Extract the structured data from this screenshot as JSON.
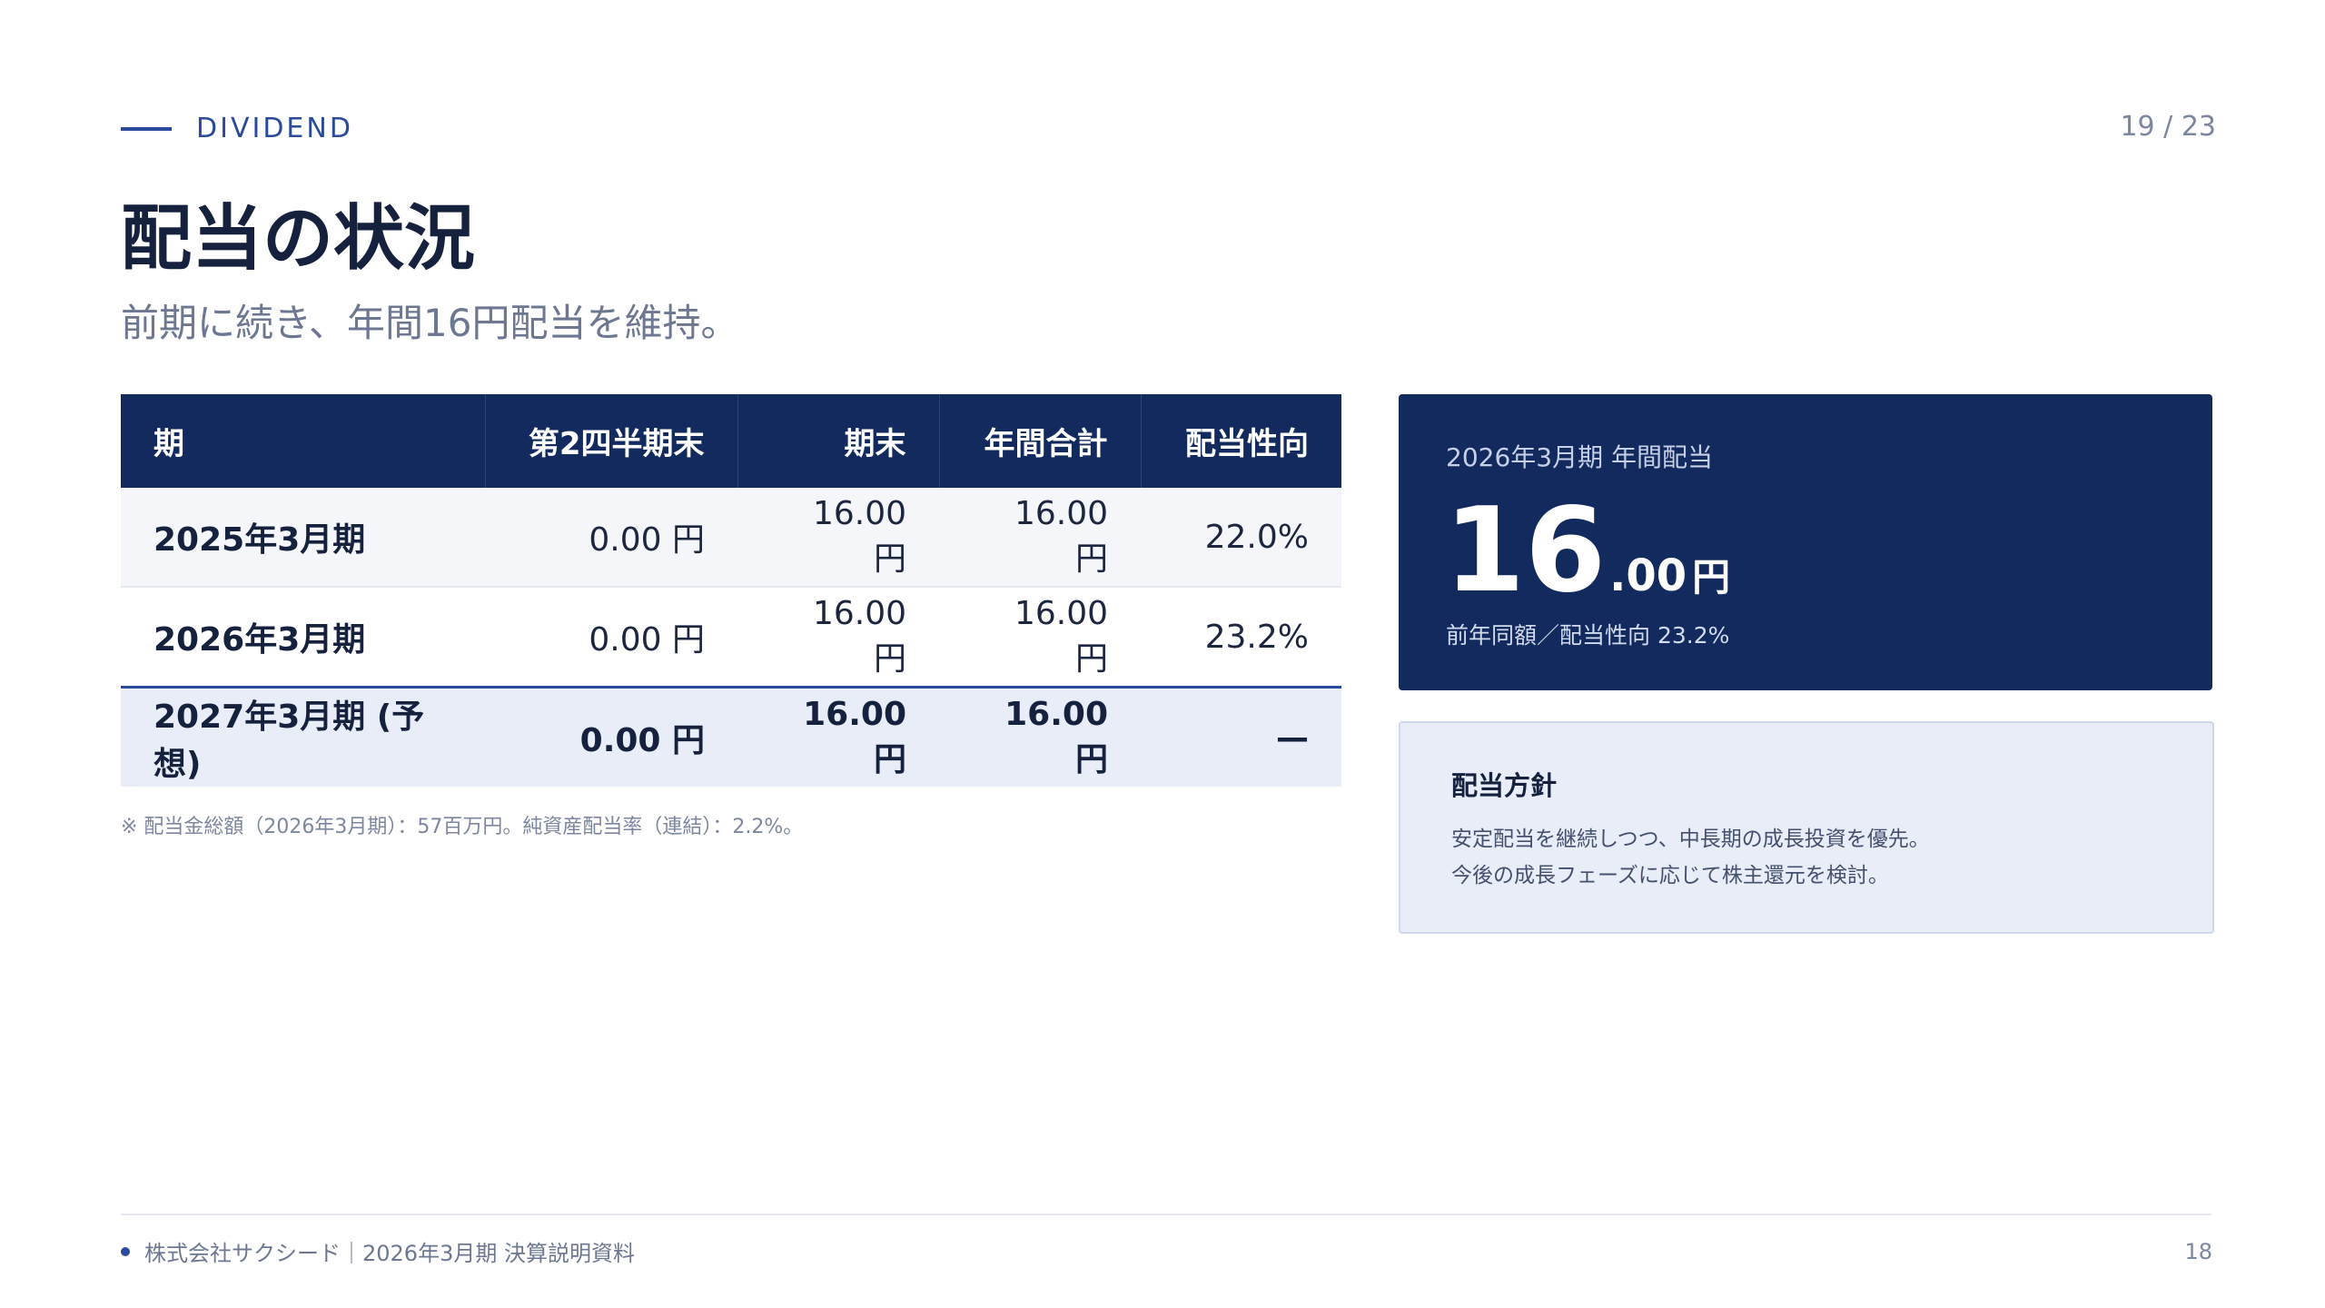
{
  "header": {
    "section_label": "DIVIDEND",
    "page_counter": "19 / 23",
    "title": "配当の状況",
    "subtitle": "前期に続き、年間16円配当を維持。"
  },
  "table": {
    "columns": [
      "期",
      "第2四半期末",
      "期末",
      "年間合計",
      "配当性向"
    ],
    "rows": [
      [
        "2025年3月期",
        "0.00 円",
        "16.00 円",
        "16.00 円",
        "22.0%"
      ],
      [
        "2026年3月期",
        "0.00 円",
        "16.00 円",
        "16.00 円",
        "23.2%"
      ],
      [
        "2027年3月期 (予想)",
        "0.00 円",
        "16.00 円",
        "16.00 円",
        "—"
      ]
    ],
    "note": "※ 配当金総額（2026年3月期）：57百万円。純資産配当率（連結）：2.2%。"
  },
  "highlight": {
    "label": "2026年3月期 年間配当",
    "value_int": "16",
    "value_dec": ".00",
    "unit": "円",
    "note": "前年同額／配当性向 23.2%"
  },
  "policy": {
    "title": "配当方針",
    "line1": "安定配当を継続しつつ、中長期の成長投資を優先。",
    "line2": "今後の成長フェーズに応じて株主還元を検討。"
  },
  "footer": {
    "company": "株式会社サクシード｜2026年3月期 決算説明資料",
    "page_number": "18"
  }
}
